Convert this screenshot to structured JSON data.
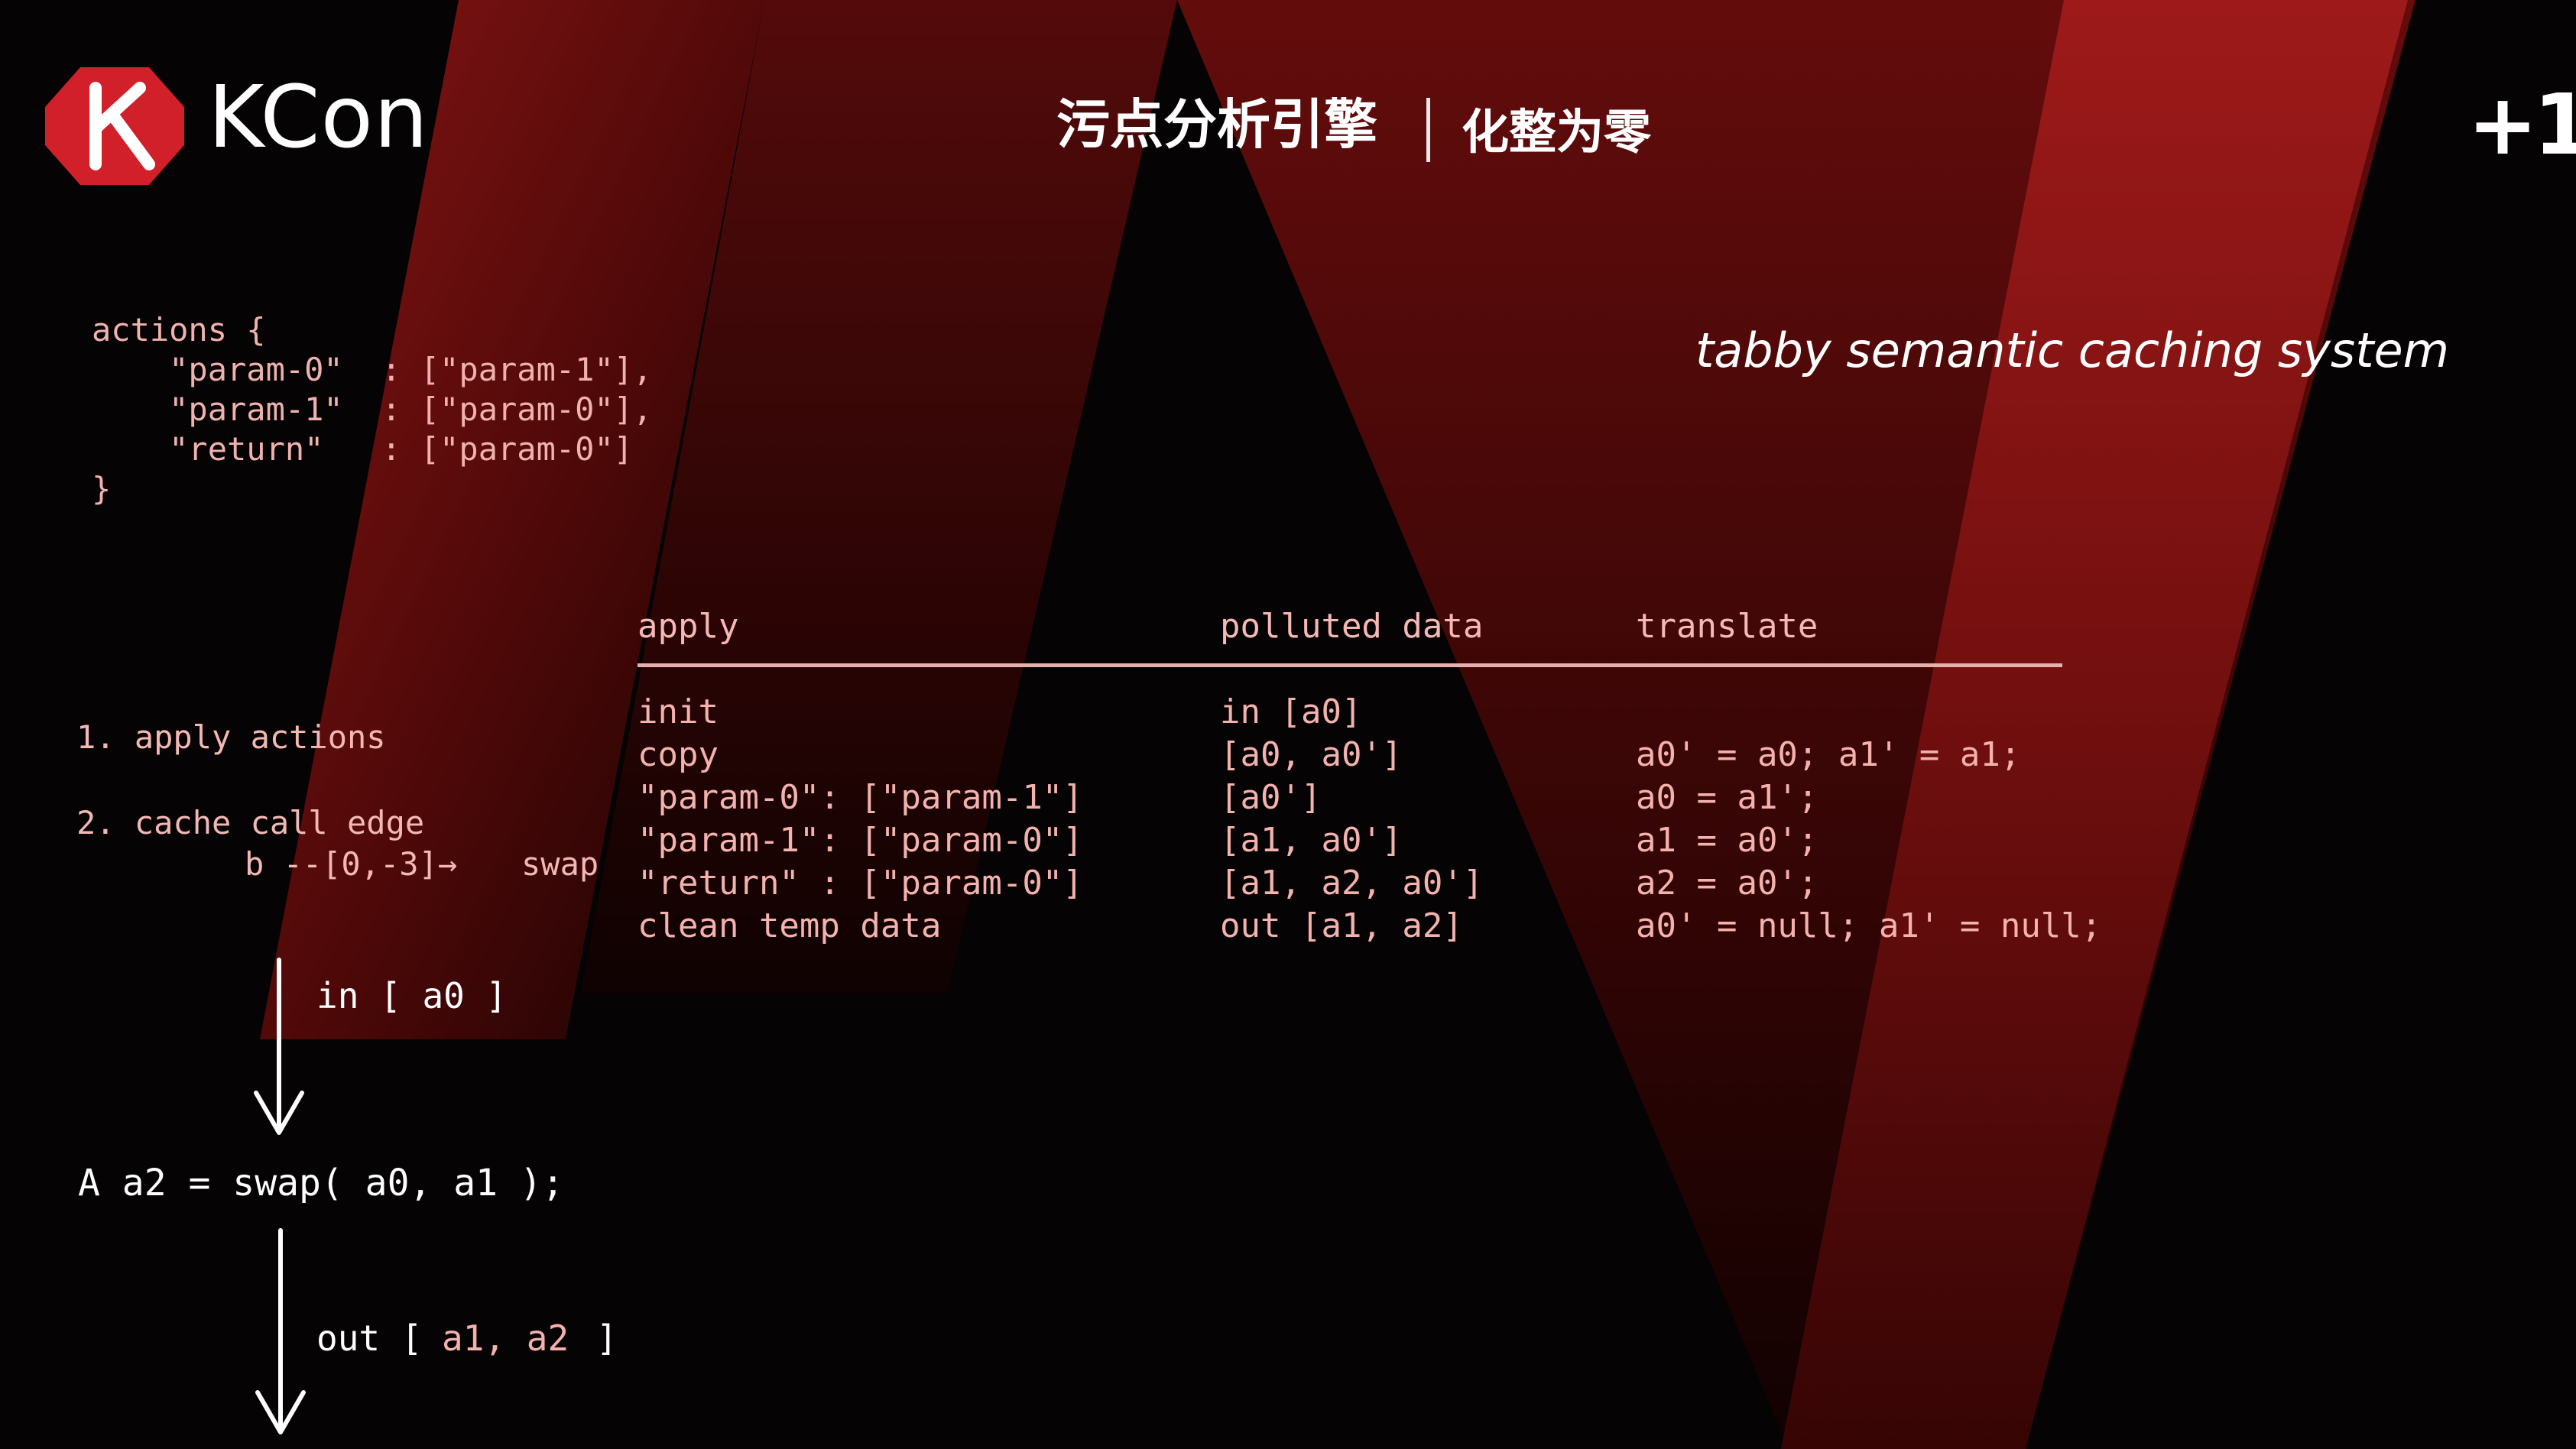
{
  "header": {
    "brand": "KCon",
    "title_main": "污点分析引擎",
    "title_sub": "化整为零",
    "corner_mark": "+1"
  },
  "actions_code": "actions {\n    \"param-0\"  : [\"param-1\"],\n    \"param-1\"  : [\"param-0\"],\n    \"return\"   : [\"param-0\"]\n}",
  "semantic_label": "tabby semantic caching system",
  "table": {
    "headers": [
      "apply",
      "polluted data",
      "translate"
    ],
    "rows": [
      [
        "init",
        "in [a0]",
        ""
      ],
      [
        "copy",
        "[a0, a0']",
        "a0' = a0; a1' = a1;"
      ],
      [
        "\"param-0\": [\"param-1\"]",
        "[a0']",
        "a0 = a1';"
      ],
      [
        "\"param-1\": [\"param-0\"]",
        "[a1, a0']",
        "a1 = a0';"
      ],
      [
        "\"return\" : [\"param-0\"]",
        "[a1, a2, a0']",
        "a2 = a0';"
      ],
      [
        "clean temp data",
        "out [a1, a2]",
        "a0' = null; a1' = null;"
      ]
    ]
  },
  "steps": {
    "step1": "1. apply actions",
    "step2": "2. cache call edge",
    "edge": "b --[0,-3]→",
    "edge_target": "swap"
  },
  "flow": {
    "in_label": "in [ a0 ]",
    "call": "A a2 = swap( a0, a1 );",
    "out_label": "out [",
    "out_args": "a1, a2",
    "out_close": "]"
  },
  "colors": {
    "background": "#050303",
    "stripe_red": "#8c1212",
    "stripe_dark": "#3a0606",
    "code_pink": "#f4b2ae",
    "logo_red": "#d1202a"
  }
}
